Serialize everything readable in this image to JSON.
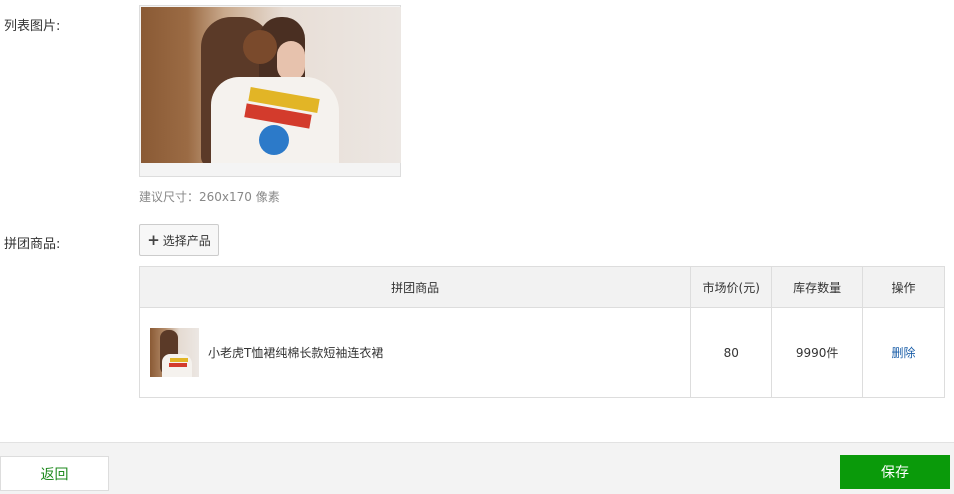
{
  "form": {
    "list_image_label": "列表图片:",
    "size_hint": "建议尺寸：260x170 像素",
    "group_product_label": "拼团商品:",
    "select_product_button": "选择产品"
  },
  "table": {
    "headers": [
      "拼团商品",
      "市场价(元)",
      "库存数量",
      "操作"
    ],
    "rows": [
      {
        "name": "小老虎T恤裙纯棉长款短袖连衣裙",
        "price": "80",
        "stock": "9990件",
        "action": "删除"
      }
    ]
  },
  "footer": {
    "back_label": "返回",
    "save_label": "保存"
  },
  "colors": {
    "save_button": "#0a9a0a",
    "back_text": "#1e8a1e",
    "link": "#1a5ea8"
  }
}
